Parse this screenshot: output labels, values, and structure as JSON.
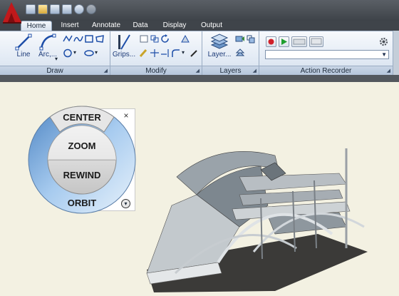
{
  "app": {
    "logo_letter": "A"
  },
  "quick_access": {
    "icons": [
      "new-icon",
      "open-icon",
      "save-icon",
      "plot-icon",
      "undo-icon",
      "redo-icon"
    ]
  },
  "tabs": [
    {
      "label": "Home",
      "active": true
    },
    {
      "label": "Insert",
      "active": false
    },
    {
      "label": "Annotate",
      "active": false
    },
    {
      "label": "Data",
      "active": false
    },
    {
      "label": "Display",
      "active": false
    },
    {
      "label": "Output",
      "active": false
    }
  ],
  "ribbon": {
    "draw": {
      "title": "Draw",
      "line_label": "Line",
      "arc_label": "Arc,..."
    },
    "modify": {
      "title": "Modify",
      "grips_label": "Grips..."
    },
    "layers": {
      "title": "Layers",
      "layer_label": "Layer..."
    },
    "action_recorder": {
      "title": "Action Recorder",
      "dropdown_value": ""
    }
  },
  "nav_wheel": {
    "segments": [
      "CENTER",
      "ZOOM",
      "REWIND",
      "ORBIT"
    ],
    "close_glyph": "×",
    "menu_glyph": "▾"
  },
  "colors": {
    "ribbon_bg": "#e3ebf5",
    "tab_bar": "#3f444a",
    "canvas": "#f3f1e2",
    "wheel_ring": "#7fb0de",
    "wheel_gray": "#cfcfcf"
  }
}
